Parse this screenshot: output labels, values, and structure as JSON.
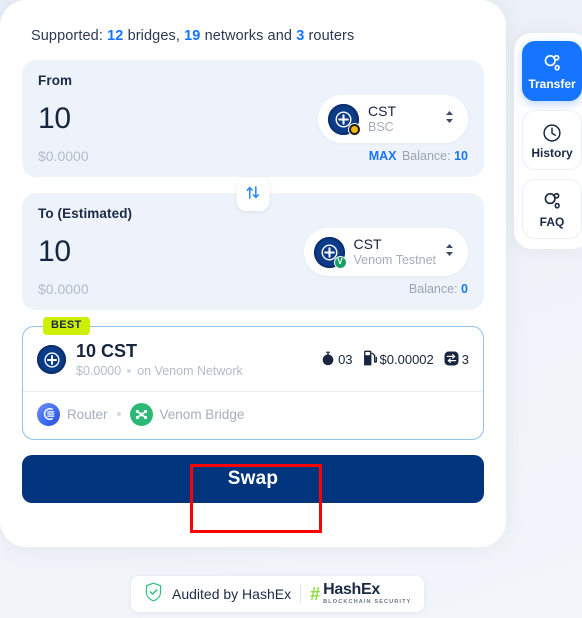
{
  "theme": {
    "accent_blue": "#1675ff",
    "deep_navy": "#00357d",
    "best_badge_green": "#ccf000",
    "page_bg": "#eef2f8",
    "panel_bg": "#eef3fb"
  },
  "supported": {
    "prefix": "Supported:",
    "bridges_count": "12",
    "bridges_word": "bridges,",
    "networks_count": "19",
    "networks_word": "networks and",
    "routers_count": "3",
    "routers_word": "routers"
  },
  "from_panel": {
    "label": "From",
    "amount": "10",
    "amount_placeholder": "0.0",
    "usd_value": "$0.0000",
    "max_label": "MAX",
    "balance_label": "Balance:",
    "balance_value": "10",
    "token": {
      "symbol": "CST",
      "chain": "BSC",
      "icon": "cst-token-icon",
      "chain_badge": "bsc-chain-badge"
    }
  },
  "swap_direction": {
    "icon": "swap-vertical-arrows-icon"
  },
  "to_panel": {
    "label": "To (Estimated)",
    "amount": "10",
    "amount_placeholder": "0.0",
    "usd_value": "$0.0000",
    "balance_label": "Balance:",
    "balance_value": "0",
    "token": {
      "symbol": "CST",
      "chain": "Venom Testnet",
      "icon": "cst-token-icon",
      "chain_badge": "venom-chain-badge"
    }
  },
  "route": {
    "best_badge": "BEST",
    "amount": "10 CST",
    "usd_value": "$0.0000",
    "network_text": "on Venom Network",
    "stats": {
      "time_icon": "stopwatch-icon",
      "time_value": "03",
      "gas_icon": "gas-pump-icon",
      "gas_value": "$0.00002",
      "steps_icon": "swap-steps-icon",
      "steps_value": "3"
    },
    "providers": [
      {
        "name": "Router",
        "icon": "router-protocol-icon"
      },
      {
        "name": "Venom Bridge",
        "icon": "venom-bridge-icon"
      }
    ]
  },
  "swap_button": {
    "label": "Swap"
  },
  "side_nav": {
    "items": [
      {
        "label": "Transfer",
        "icon": "transfer-bubbles-icon",
        "active": true
      },
      {
        "label": "History",
        "icon": "clock-icon",
        "active": false
      },
      {
        "label": "FAQ",
        "icon": "faq-bubbles-icon",
        "active": false
      }
    ]
  },
  "footer": {
    "audit_text": "Audited by HashEx",
    "logo_hash": "#",
    "logo_name": "HashEx",
    "logo_sub": "BLOCKCHAIN SECURITY",
    "shield_icon": "shield-check-icon"
  }
}
